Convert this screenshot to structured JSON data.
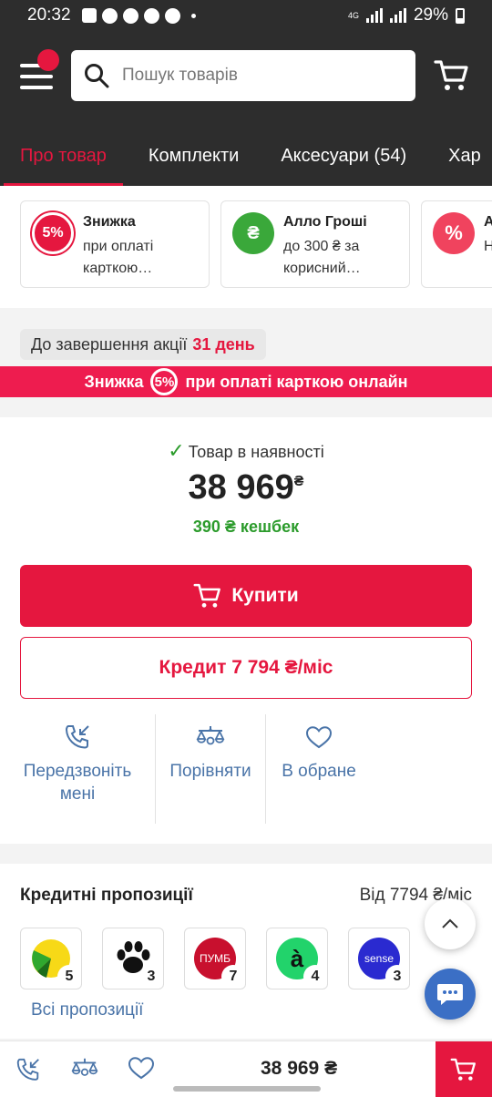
{
  "status_bar": {
    "time": "20:32",
    "network": "4G",
    "battery": "29%"
  },
  "header": {
    "search_placeholder": "Пошук товарів"
  },
  "tabs": [
    {
      "label": "Про товар",
      "active": true
    },
    {
      "label": "Комплекти",
      "active": false
    },
    {
      "label": "Аксесуари (54)",
      "active": false
    },
    {
      "label": "Хар",
      "active": false
    }
  ],
  "promos": [
    {
      "badge": "5%",
      "title": "Знижка",
      "desc": "при оплаті карткою…",
      "color": "#e5173f"
    },
    {
      "badge": "₴",
      "title": "Алло Гроші",
      "desc": "до 300 ₴ за корисний…",
      "color": "#3aa83a"
    },
    {
      "badge": "%",
      "title": "А",
      "desc": "Н ч",
      "color": "#f0435e"
    }
  ],
  "countdown": {
    "label": "До завершення акції",
    "value": "31 день"
  },
  "banner": {
    "before": "Знижка",
    "badge": "5%",
    "after": "при оплаті карткою онлайн"
  },
  "product": {
    "availability": "Товар в наявності",
    "price": "38 969",
    "currency": "₴",
    "cashback": "390 ₴ кешбек",
    "buy_label": "Купити",
    "credit_label": "Кредит 7 794 ₴/міс"
  },
  "actions": {
    "callback": "Передзвоніть мені",
    "compare": "Порівняти",
    "favorite": "В обране"
  },
  "credit": {
    "title": "Кредитні пропозиції",
    "from": "Від 7794 ₴/міс",
    "all_offers": "Всі пропозиції",
    "banks": [
      {
        "name": "bank-1",
        "count": "5"
      },
      {
        "name": "bank-paw",
        "count": "3"
      },
      {
        "name": "bank-pumb",
        "label": "ПУМБ",
        "count": "7"
      },
      {
        "name": "bank-a",
        "label": "à",
        "count": "4"
      },
      {
        "name": "bank-sense",
        "label": "sense",
        "count": "3"
      }
    ]
  },
  "bottom_bar": {
    "price": "38 969 ₴"
  },
  "colors": {
    "accent": "#e5173f",
    "header_bg": "#2d2d2d",
    "link": "#4a74a8",
    "success": "#2b9b2b"
  }
}
